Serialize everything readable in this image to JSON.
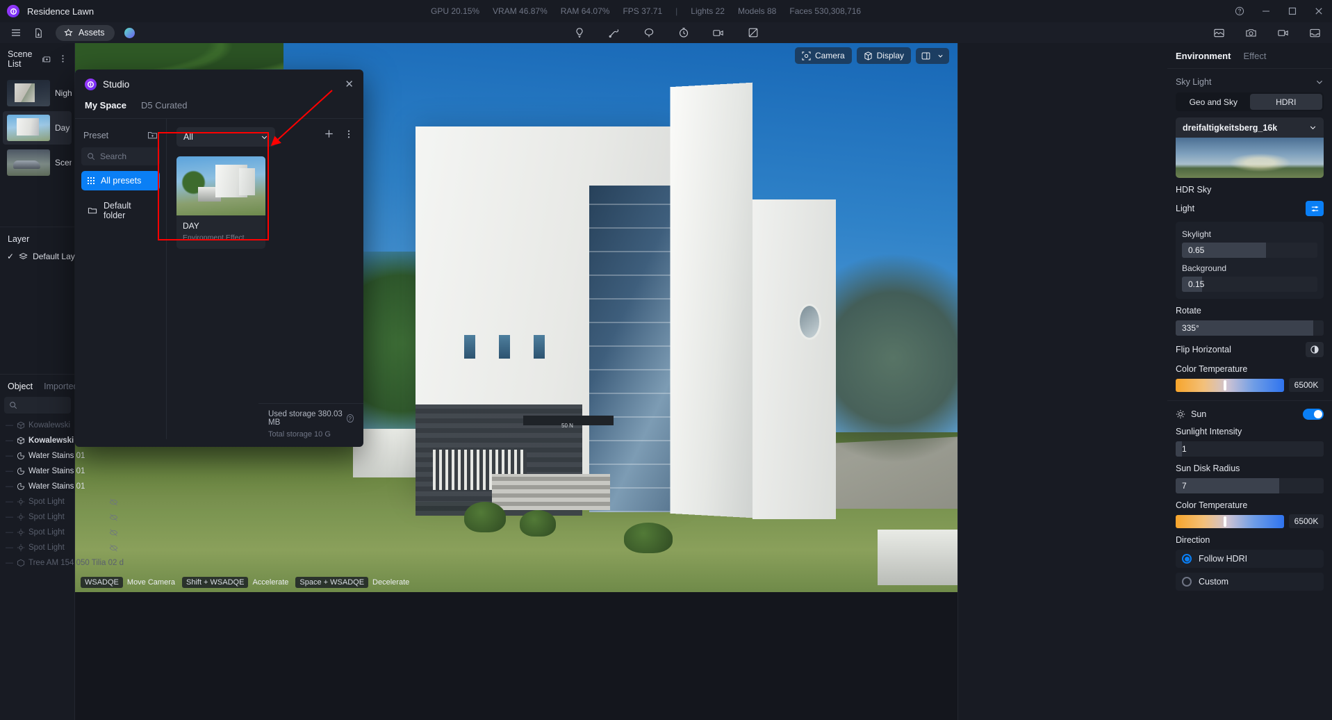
{
  "titlebar": {
    "app_title": "Residence Lawn",
    "logo": "d5-logo-icon",
    "stats": [
      {
        "label": "GPU 20.15%"
      },
      {
        "label": "VRAM 46.87%"
      },
      {
        "label": "RAM 64.07%"
      },
      {
        "label": "FPS 37.71"
      },
      {
        "label": "|"
      },
      {
        "label": "Lights 22"
      },
      {
        "label": "Models 88"
      },
      {
        "label": "Faces 530,308,716"
      }
    ],
    "window_buttons": [
      "help",
      "minimize",
      "maximize",
      "close"
    ]
  },
  "toolbar": {
    "menu_label": "menu",
    "file_label": "file",
    "assets_label": "Assets",
    "center_tools": [
      "light-bulb",
      "wrench",
      "paint",
      "timer",
      "video",
      "no-effect"
    ],
    "right_tools": [
      "render-image",
      "camera",
      "video-camera",
      "inbox"
    ]
  },
  "left_panel": {
    "scene_list_title": "Scene List",
    "scenes": [
      {
        "name": "Night",
        "thumb": "night"
      },
      {
        "name": "Day",
        "thumb": "day"
      },
      {
        "name": "Scene",
        "thumb": "scene"
      }
    ],
    "layer_title": "Layer",
    "layers": [
      {
        "name": "Default Layer",
        "checked": "✓"
      }
    ],
    "object_tabs": [
      {
        "label": "Object",
        "active": true
      },
      {
        "label": "Imported",
        "active": false
      }
    ],
    "object_search_placeholder": "",
    "objects": [
      {
        "name": "Kowalewski",
        "icon": "cube-icon",
        "dim": true,
        "hidden": false
      },
      {
        "name": "Kowalewski",
        "icon": "cube-icon",
        "dim": false,
        "hidden": false
      },
      {
        "name": "Water Stains 01",
        "icon": "material-icon",
        "dim": false,
        "hidden": false
      },
      {
        "name": "Water Stains 01",
        "icon": "material-icon",
        "dim": false,
        "hidden": false
      },
      {
        "name": "Water Stains 01",
        "icon": "material-icon",
        "dim": false,
        "hidden": false
      },
      {
        "name": "Spot Light",
        "icon": "light-icon",
        "dim": true,
        "hidden": true
      },
      {
        "name": "Spot Light",
        "icon": "light-icon",
        "dim": true,
        "hidden": true
      },
      {
        "name": "Spot Light",
        "icon": "light-icon",
        "dim": true,
        "hidden": true
      },
      {
        "name": "Spot Light",
        "icon": "light-icon",
        "dim": true,
        "hidden": true
      },
      {
        "name": "Tree AM 154 050 Tilia 02 d",
        "icon": "cube-icon",
        "dim": true,
        "hidden": false
      }
    ]
  },
  "viewport": {
    "camera_button": "Camera",
    "display_button": "Display",
    "layout_button": "layout-grid",
    "hints": [
      {
        "key": "WSADQE",
        "label": "Move Camera"
      },
      {
        "key": "Shift + WSADQE",
        "label": "Accelerate"
      },
      {
        "key": "Space + WSADQE",
        "label": "Decelerate"
      }
    ]
  },
  "studio": {
    "title": "Studio",
    "logo": "d5-logo-icon",
    "close_label": "✕",
    "tabs": [
      {
        "label": "My Space",
        "active": true
      },
      {
        "label": "D5 Curated",
        "active": false
      }
    ],
    "preset_label": "Preset",
    "new_folder_icon": "folder-plus-icon",
    "search_placeholder": "Search",
    "folders": [
      {
        "label": "All presets",
        "icon": "grid-dots-icon",
        "active": true
      },
      {
        "label": "Default folder",
        "icon": "folder-icon",
        "active": false
      }
    ],
    "filter_value": "All",
    "add_icon": "plus-icon",
    "more_icon": "more-icon",
    "presets": [
      {
        "name": "DAY",
        "subtitle": "Environment Effect"
      }
    ],
    "storage_used": "Used storage 380.03 MB",
    "storage_total": "Total storage 10 G"
  },
  "right_panel": {
    "tabs": [
      {
        "label": "Environment",
        "active": true
      },
      {
        "label": "Effect",
        "active": false
      }
    ],
    "sky_light": {
      "section_title": "Sky Light",
      "modes": [
        {
          "label": "Geo and Sky",
          "active": false
        },
        {
          "label": "HDRI",
          "active": true
        }
      ],
      "hdri_name": "dreifaltigkeitsberg_16k",
      "hdr_sky_label": "HDR Sky",
      "light_label": "Light",
      "light_button_icon": "sliders-icon",
      "skylight_label": "Skylight",
      "skylight_value": "0.65",
      "skylight_fill_pct": 62,
      "background_label": "Background",
      "background_value": "0.15",
      "background_fill_pct": 15,
      "rotate_label": "Rotate",
      "rotate_value": "335°",
      "rotate_fill_pct": 93,
      "flip_horizontal_label": "Flip Horizontal",
      "flip_icon": "contrast-icon",
      "color_temperature_label": "Color Temperature",
      "color_temperature_value": "6500K",
      "color_temperature_pct": 44
    },
    "sun": {
      "title": "Sun",
      "icon": "sun-icon",
      "enabled": true,
      "sunlight_intensity_label": "Sunlight Intensity",
      "sunlight_intensity_value": "1",
      "sunlight_intensity_pct": 4,
      "sun_disk_radius_label": "Sun Disk Radius",
      "sun_disk_radius_value": "7",
      "sun_disk_radius_pct": 70,
      "color_temperature_label": "Color Temperature",
      "color_temperature_value": "6500K",
      "color_temperature_pct": 44,
      "direction_label": "Direction",
      "direction_options": [
        {
          "label": "Follow HDRI",
          "selected": true
        },
        {
          "label": "Custom",
          "selected": false
        }
      ]
    }
  },
  "colors": {
    "accent": "#0a7ff5",
    "annotation": "#ff0000",
    "panel_bg": "#181b23",
    "titlebar_bg": "#181b23"
  }
}
